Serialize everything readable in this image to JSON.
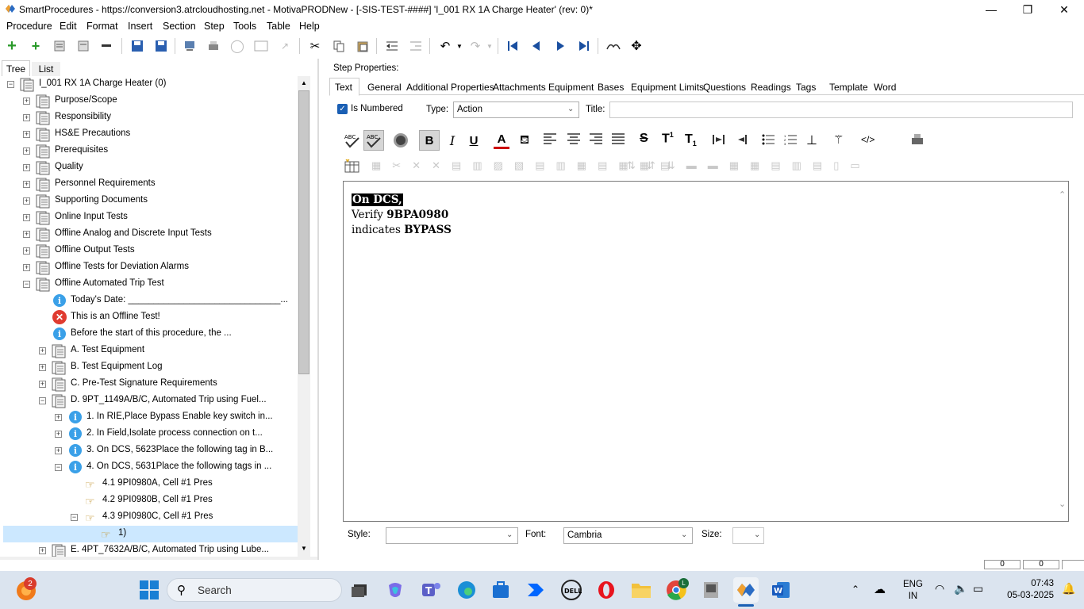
{
  "window": {
    "title": "SmartProcedures - https://conversion3.atrcloudhosting.net - MotivaPRODNew - [-SIS-TEST-####] 'I_001 RX 1A Charge Heater' (rev: 0)*",
    "minimize": "—",
    "maximize": "❐",
    "close": "✕"
  },
  "menu": [
    "Procedure",
    "Edit",
    "Format",
    "Insert",
    "Section",
    "Step",
    "Tools",
    "Table",
    "Help"
  ],
  "left_tabs": [
    "Tree",
    "List"
  ],
  "tree": [
    {
      "label": "I_001 RX 1A Charge Heater (0)",
      "level": 0,
      "expander": "−",
      "icon": "doc"
    },
    {
      "label": "Purpose/Scope",
      "level": 1,
      "expander": "+",
      "icon": "doc"
    },
    {
      "label": "Responsibility",
      "level": 1,
      "expander": "+",
      "icon": "doc"
    },
    {
      "label": "HS&E Precautions",
      "level": 1,
      "expander": "+",
      "icon": "doc"
    },
    {
      "label": "Prerequisites",
      "level": 1,
      "expander": "+",
      "icon": "doc"
    },
    {
      "label": "Quality",
      "level": 1,
      "expander": "+",
      "icon": "doc"
    },
    {
      "label": "Personnel Requirements",
      "level": 1,
      "expander": "+",
      "icon": "doc"
    },
    {
      "label": "Supporting Documents",
      "level": 1,
      "expander": "+",
      "icon": "doc"
    },
    {
      "label": "Online Input Tests",
      "level": 1,
      "expander": "+",
      "icon": "doc"
    },
    {
      "label": "Offline Analog and Discrete Input Tests",
      "level": 1,
      "expander": "+",
      "icon": "doc"
    },
    {
      "label": "Offline Output Tests",
      "level": 1,
      "expander": "+",
      "icon": "doc"
    },
    {
      "label": "Offline Tests for Deviation Alarms",
      "level": 1,
      "expander": "+",
      "icon": "doc"
    },
    {
      "label": "Offline Automated Trip Test",
      "level": 1,
      "expander": "−",
      "icon": "doc"
    },
    {
      "label": "Today's Date: ______________________________...",
      "level": 2,
      "expander": "",
      "icon": "info"
    },
    {
      "label": "This is an Offline Test!",
      "level": 2,
      "expander": "",
      "icon": "error"
    },
    {
      "label": "Before the start of this procedure, the ...",
      "level": 2,
      "expander": "",
      "icon": "info"
    },
    {
      "label": "A. Test Equipment",
      "level": 2,
      "expander": "+",
      "icon": "doc"
    },
    {
      "label": "B. Test Equipment Log",
      "level": 2,
      "expander": "+",
      "icon": "doc"
    },
    {
      "label": "C. Pre-Test Signature Requirements",
      "level": 2,
      "expander": "+",
      "icon": "doc"
    },
    {
      "label": "D. 9PT_1149A/B/C, Automated Trip using Fuel...",
      "level": 2,
      "expander": "−",
      "icon": "doc"
    },
    {
      "label": "1. In RIE,Place Bypass Enable key switch in...",
      "level": 3,
      "expander": "+",
      "icon": "info"
    },
    {
      "label": "2. In Field,Isolate process connection on t...",
      "level": 3,
      "expander": "+",
      "icon": "info"
    },
    {
      "label": "3. On DCS, 5623Place the following tag in B...",
      "level": 3,
      "expander": "+",
      "icon": "info"
    },
    {
      "label": "4. On DCS, 5631Place the following tags in ...",
      "level": 3,
      "expander": "−",
      "icon": "info"
    },
    {
      "label": "4.1 9PI0980A, Cell #1 Pres",
      "level": 4,
      "expander": "",
      "icon": "hand"
    },
    {
      "label": "4.2 9PI0980B, Cell #1 Pres",
      "level": 4,
      "expander": "",
      "icon": "hand"
    },
    {
      "label": "4.3 9PI0980C, Cell #1 Pres",
      "level": 4,
      "expander": "−",
      "icon": "hand"
    },
    {
      "label": "1)",
      "level": 5,
      "expander": "",
      "icon": "hand",
      "selected": true
    },
    {
      "label": "E. 4PT_7632A/B/C, Automated Trip using Lube...",
      "level": 2,
      "expander": "+",
      "icon": "doc"
    }
  ],
  "step_properties": {
    "heading": "Step Properties:",
    "tabs": [
      "Text",
      "General",
      "Additional Properties",
      "Attachments",
      "Equipment",
      "Bases",
      "Equipment Limits",
      "Questions",
      "Readings",
      "Tags",
      "Template",
      "Word"
    ],
    "is_numbered_label": "Is Numbered",
    "is_numbered": true,
    "type_label": "Type:",
    "type_value": "Action",
    "title_label": "Title:",
    "title_value": ""
  },
  "editor": {
    "line1": "On DCS,",
    "line2_plain": "Verify ",
    "line2_bold": "9BPA0980",
    "line3_plain": "indicates ",
    "line3_bold": "BYPASS"
  },
  "format_bar": {
    "style_label": "Style:",
    "style_value": "",
    "font_label": "Font:",
    "font_value": "Cambria",
    "size_label": "Size:",
    "size_value": ""
  },
  "status": {
    "field1": "0",
    "field2": "0"
  },
  "taskbar": {
    "search_placeholder": "Search",
    "lang_line1": "ENG",
    "lang_line2": "IN",
    "time": "07:43",
    "date": "05-03-2025",
    "notification_count": "2"
  },
  "colors": {
    "selection": "#cce8ff",
    "accent": "#1a5fb4",
    "taskbar": "#dbe4ef"
  }
}
